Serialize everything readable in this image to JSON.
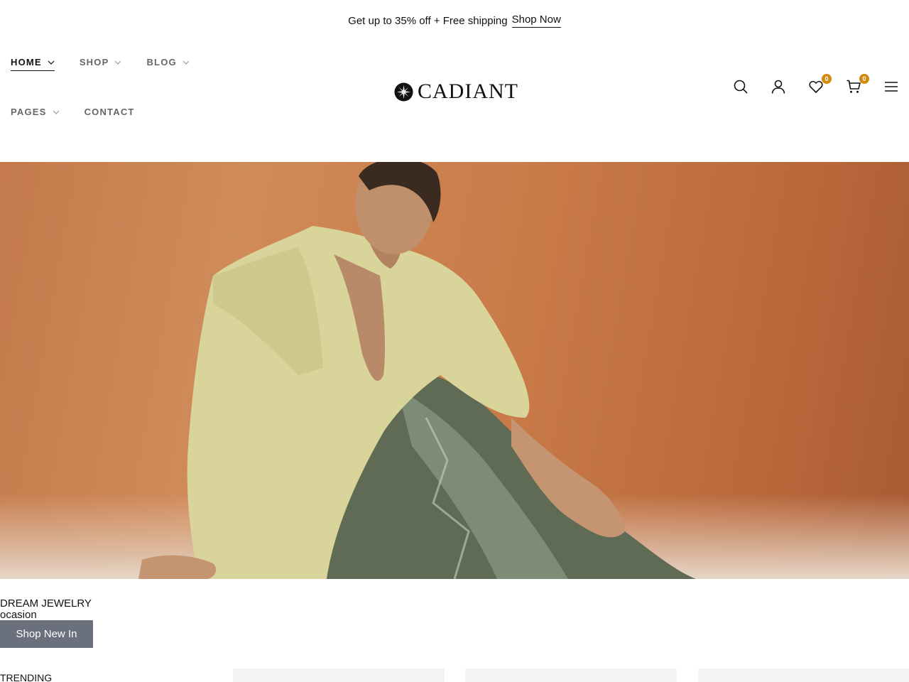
{
  "announcement": {
    "text": "Get up to 35% off + Free shipping",
    "link": "Shop Now"
  },
  "nav": {
    "items": [
      {
        "label": "HOME",
        "has_dropdown": true,
        "active": true
      },
      {
        "label": "SHOP",
        "has_dropdown": true,
        "active": false
      },
      {
        "label": "BLOG",
        "has_dropdown": true,
        "active": false
      },
      {
        "label": "PAGES",
        "has_dropdown": true,
        "active": false
      },
      {
        "label": "CONTACT",
        "has_dropdown": false,
        "active": false
      }
    ]
  },
  "brand": {
    "name": "CADIANT"
  },
  "header_icons": {
    "search": "search-icon",
    "account": "user-icon",
    "wishlist": {
      "icon": "heart-icon",
      "count": "0"
    },
    "cart": {
      "icon": "cart-icon",
      "count": "0"
    },
    "menu": "hamburger-menu-icon",
    "badge_color": "#d38a0c"
  },
  "hero": {
    "image_alt": "Woman in a pale yellow shirt and patterned trousers seated against an orange backdrop"
  },
  "promo": {
    "title": "DREAM JEWELRY",
    "subtitle": "ocasion",
    "button": "Shop New In",
    "button_color": "#6b717c"
  },
  "section": {
    "trending_label": "TRENDING"
  }
}
